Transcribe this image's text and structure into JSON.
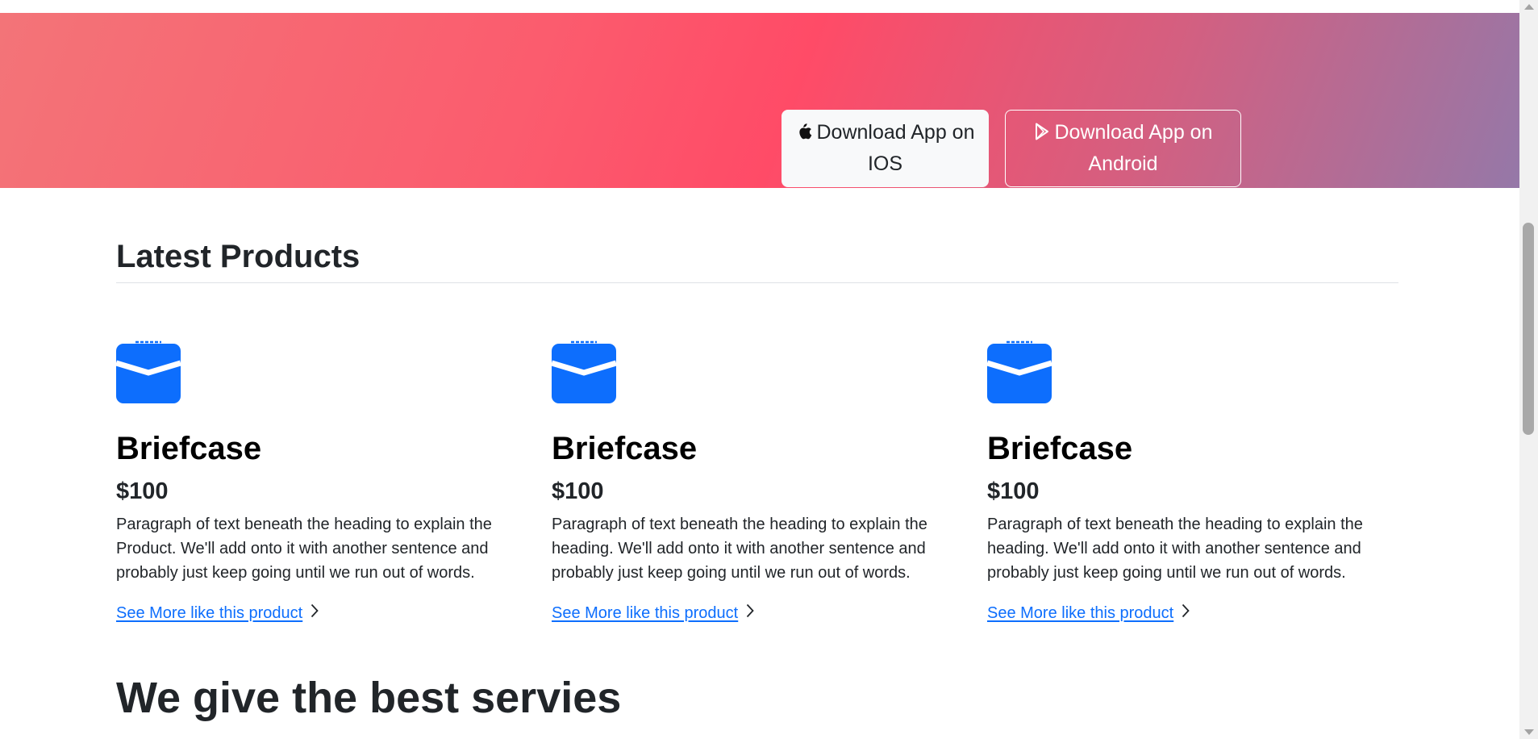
{
  "hero": {
    "ios_button_label": "Download App on IOS",
    "android_button_label": "Download App on Android",
    "ios_icon": "apple-icon",
    "android_icon": "google-play-icon"
  },
  "products_section": {
    "title": "Latest Products",
    "items": [
      {
        "icon": "briefcase-icon",
        "name": "Briefcase",
        "price": "$100",
        "description": "Paragraph of text beneath the heading to explain the Product. We'll add onto it with another sentence and probably just keep going until we run out of words.",
        "link_label": "See More like this product"
      },
      {
        "icon": "briefcase-icon",
        "name": "Briefcase",
        "price": "$100",
        "description": "Paragraph of text beneath the heading to explain the heading. We'll add onto it with another sentence and probably just keep going until we run out of words.",
        "link_label": "See More like this product"
      },
      {
        "icon": "briefcase-icon",
        "name": "Briefcase",
        "price": "$100",
        "description": "Paragraph of text beneath the heading to explain the heading. We'll add onto it with another sentence and probably just keep going until we run out of words.",
        "link_label": "See More like this product"
      }
    ]
  },
  "services_section": {
    "title": "We give the best servies"
  },
  "colors": {
    "accent": "#0d6efd",
    "hero_gradient": [
      "#f37478",
      "#ff4b67",
      "#9578a8"
    ],
    "text": "#212529"
  }
}
